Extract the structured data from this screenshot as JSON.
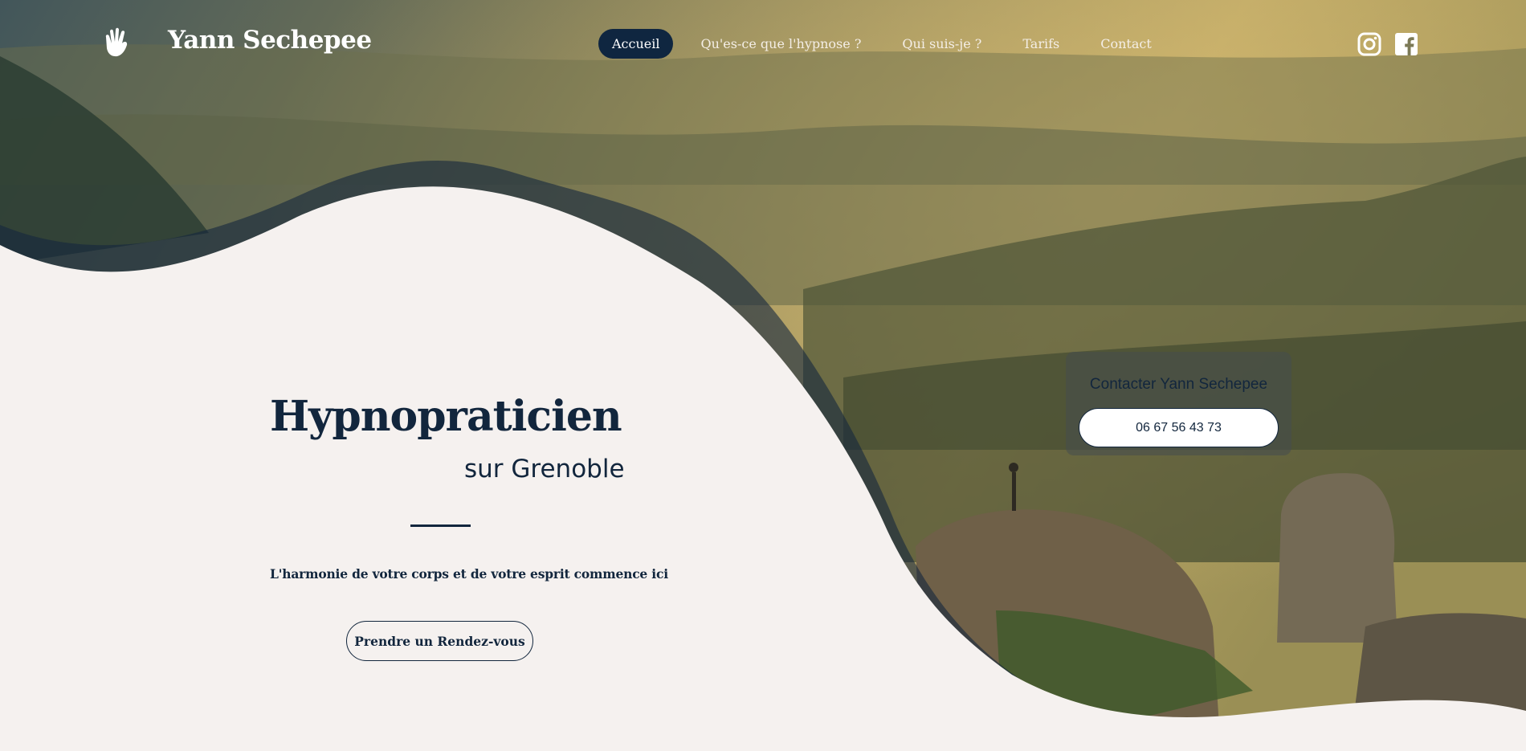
{
  "header": {
    "brand": "Yann Sechepee",
    "nav": [
      "Accueil",
      "Qu'es-ce que l'hypnose ?",
      "Qui suis-je ?",
      "Tarifs",
      "Contact"
    ],
    "active_nav": "Accueil",
    "social_icons": [
      "instagram-icon",
      "facebook-icon"
    ]
  },
  "hero": {
    "title": "Hypnopraticien",
    "subtitle": "sur Grenoble",
    "tagline": "L'harmonie de votre corps et de votre esprit commence ici",
    "cta_label": "Prendre un Rendez-vous"
  },
  "contact_card": {
    "title": "Contacter Yann Sechepee",
    "phone": "06 67 56 43 73"
  },
  "colors": {
    "navy": "#12263d",
    "nav_active_bg": "#0f2640",
    "cream": "#f5f1ef"
  }
}
